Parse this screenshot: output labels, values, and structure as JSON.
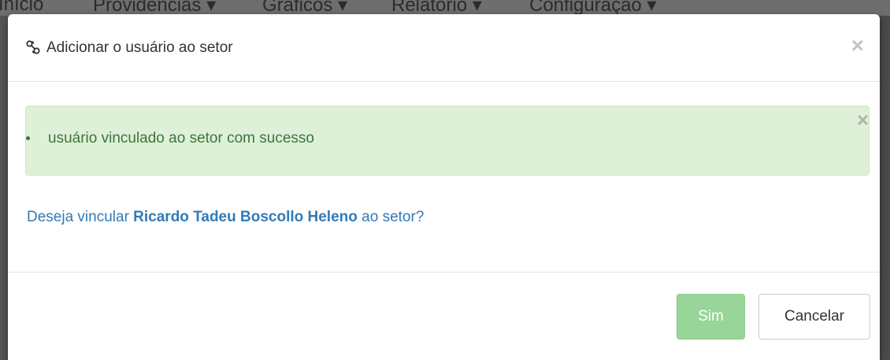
{
  "background_nav": {
    "items": [
      "Início",
      "Providências ▾",
      "Gráficos ▾",
      "Relatório ▾",
      "Configuração ▾"
    ]
  },
  "modal": {
    "title": "Adicionar o usuário ao setor",
    "title_icon": "link-icon",
    "close_label": "×"
  },
  "alert": {
    "message": "usuário vinculado ao setor com sucesso",
    "close_label": "×",
    "color": "#dff0d8"
  },
  "question": {
    "prefix": "Deseja vincular ",
    "user_name": "Ricardo Tadeu Boscollo Heleno",
    "suffix": " ao setor?"
  },
  "footer": {
    "confirm_label": "Sim",
    "cancel_label": "Cancelar"
  },
  "colors": {
    "confirm_button": "#98d598",
    "link_text": "#337ab7",
    "success_text": "#3c763d"
  }
}
